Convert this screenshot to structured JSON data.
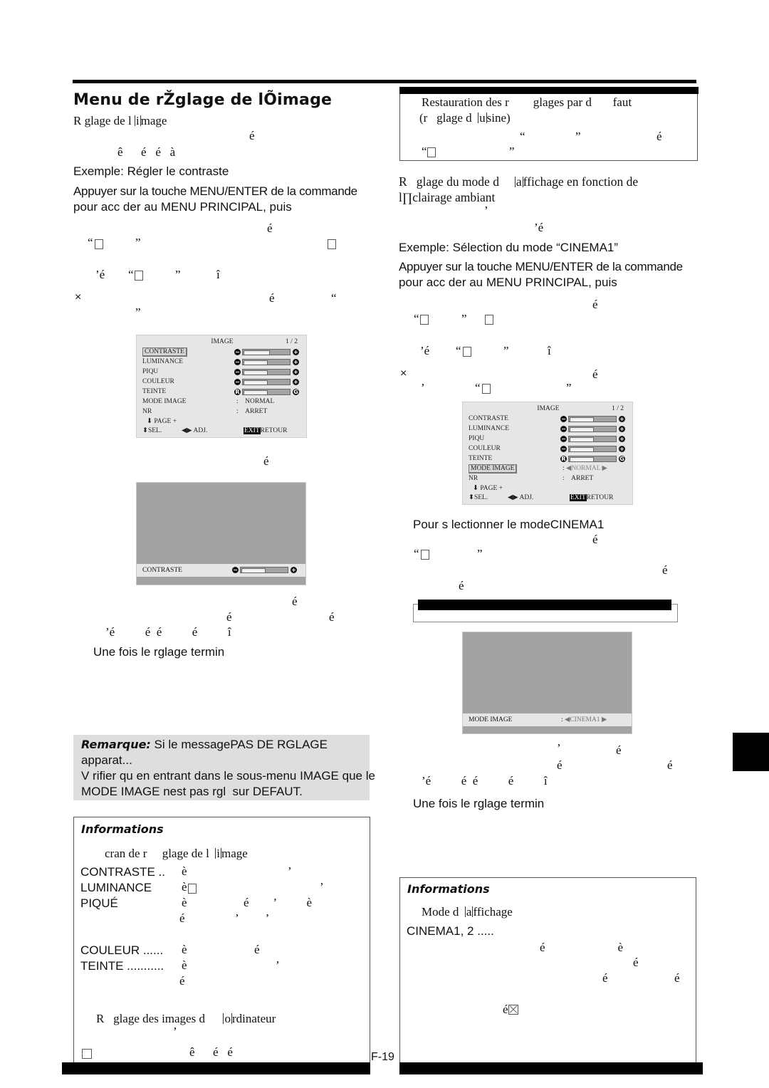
{
  "page": {
    "title": "Menu de rŽglage de lÕimage",
    "page_number": "F-19"
  },
  "left": {
    "subheading": {
      "pre": "R   glage de l  ",
      "ibeam": "i",
      "post": "mage"
    },
    "frag1": "é",
    "frag2": "ê      é   é   à",
    "example": "Exemple: Régler le contraste",
    "instruction_line1": "Appuyer sur la touche MENU/ENTER de la commande",
    "instruction_line2": "pour acc der au MENU PRINCIPAL, puis",
    "step_frag_a": "é",
    "step_frag_b_open": "“",
    "step_frag_b_close": "”",
    "step_frag_c": "’é",
    "step_frag_d": "î",
    "step_frag_e": "é",
    "step_frag_f": "“",
    "step_frag_g": "”",
    "osd_caption_frag": "é",
    "after_frag1": "é",
    "after_frag2a": "é",
    "after_frag2b": "é",
    "after_frag3": "’é          é  é          é          î",
    "done_text": "Une fois le rglage termin",
    "remark": {
      "label": "Remarque:",
      "line1": " Si le messagePAS DE RGLAGE",
      "line2": "apparat...",
      "line3": "V rifier qu en entrant dans le sous-menu IMAGE que le",
      "line4": "MODE IMAGE nest pas rgl  sur DEFAUT."
    },
    "info": {
      "title": "Informations",
      "subheading": {
        "pre": "cran de r     glage de l  ",
        "ibeam": "i",
        "post": "mage"
      },
      "terms": [
        {
          "term": "CONTRASTE ..",
          "desc": "è",
          "extra": "’"
        },
        {
          "term": "LUMINANCE",
          "desc": "è",
          "extra": "’"
        },
        {
          "term": "PIQUÉ",
          "desc": "è",
          "extra": "é        ’          è"
        },
        {
          "term": "",
          "desc": "é",
          "extra": "’         ’"
        },
        {
          "term": "COULEUR ......",
          "desc": "è",
          "extra": "é"
        },
        {
          "term": "TEINTE ...........",
          "desc": "è",
          "extra": "’"
        },
        {
          "term": "",
          "desc": "é",
          "extra": ""
        }
      ],
      "computer_heading": {
        "pre": "R   glage des images d      ",
        "ibeam": "o",
        "post": "rdinateur"
      },
      "computer_frag1": "’",
      "computer_frag2": "ê      é   é"
    }
  },
  "osd_main_left": {
    "header": "IMAGE",
    "page": "1 / 2",
    "rows": [
      {
        "label": "CONTRASTE",
        "type": "slider",
        "left": "−",
        "right": "+",
        "level": 0.55,
        "highlight": true
      },
      {
        "label": "LUMINANCE",
        "type": "slider",
        "left": "−",
        "right": "+",
        "level": 0.5
      },
      {
        "label": "PIQU",
        "type": "slider",
        "left": "−",
        "right": "+",
        "level": 0.5
      },
      {
        "label": "COULEUR",
        "type": "slider",
        "left": "−",
        "right": "+",
        "level": 0.5
      },
      {
        "label": "TEINTE",
        "type": "slider",
        "left": "R",
        "right": "G",
        "level": 0.5
      },
      {
        "label": "MODE IMAGE",
        "type": "value",
        "value": "NORMAL"
      },
      {
        "label": "NR",
        "type": "value",
        "value": "ARRET"
      }
    ],
    "nav_page": "PAGE   +",
    "nav_sel": "SEL.",
    "nav_adj": "ADJ.",
    "nav_exit": "EXIT",
    "nav_return": "RETOUR"
  },
  "osd_single_left": {
    "label": "CONTRASTE",
    "level": 0.5
  },
  "right": {
    "reset_box": {
      "line1": "Restauration des r        glages par d       faut",
      "line2": {
        "pre": "(r   glage d  ",
        "ibeam": "u",
        "post": "sine)"
      },
      "frag_open": "“",
      "frag_close": "”",
      "frag_e": "é"
    },
    "heading_line1": {
      "pre": "R   glage du mode d     ",
      "ibeam": "a",
      "post": "ffichage en fonction de"
    },
    "heading_line2": "l∏clairage ambiant",
    "frag_comma": "’",
    "frag_e1": "’é",
    "example": "Exemple: Sélection du mode “CINEMA1”",
    "instruction_line1": "Appuyer sur la touche MENU/ENTER de la commande",
    "instruction_line2": "pour acc der au MENU PRINCIPAL, puis",
    "step_e": "é",
    "step_e2": "’é",
    "step_i": "î",
    "step_e3": "é",
    "step_comma": "’",
    "select_text": "Pour s lectionner le modeCINEMA1",
    "select_frag_e": "é",
    "select_frag_e2": "é",
    "select_frag_e3": "é",
    "after_frag1a": "’",
    "after_frag1b": "é",
    "after_frag2a": "é",
    "after_frag2b": "é",
    "after_frag3": "’é          é  é          é          î",
    "done_text": "Une fois le rglage termin",
    "info": {
      "title": "Informations",
      "subheading": {
        "pre": "Mode d  ",
        "ibeam": "a",
        "post": "ffichage"
      },
      "term": "CINEMA1, 2 .....",
      "frag_rows": [
        "é                        è",
        "é",
        "é                      é",
        "é"
      ]
    }
  },
  "osd_main_right": {
    "header": "IMAGE",
    "page": "1 / 2",
    "rows": [
      {
        "label": "CONTRASTE",
        "type": "slider",
        "left": "−",
        "right": "+",
        "level": 0.5
      },
      {
        "label": "LUMINANCE",
        "type": "slider",
        "left": "−",
        "right": "+",
        "level": 0.5
      },
      {
        "label": "PIQU",
        "type": "slider",
        "left": "−",
        "right": "+",
        "level": 0.5
      },
      {
        "label": "COULEUR",
        "type": "slider",
        "left": "−",
        "right": "+",
        "level": 0.5
      },
      {
        "label": "TEINTE",
        "type": "slider",
        "left": "R",
        "right": "G",
        "level": 0.5
      },
      {
        "label": "MODE IMAGE",
        "type": "select",
        "value": "NORMAL",
        "highlight": true
      },
      {
        "label": "NR",
        "type": "value",
        "value": "ARRET"
      }
    ],
    "nav_page": "PAGE   +",
    "nav_sel": "SEL.",
    "nav_adj": "ADJ.",
    "nav_exit": "EXIT",
    "nav_return": "RETOUR"
  },
  "osd_single_right": {
    "label": "MODE IMAGE",
    "value": "CINEMA1"
  }
}
